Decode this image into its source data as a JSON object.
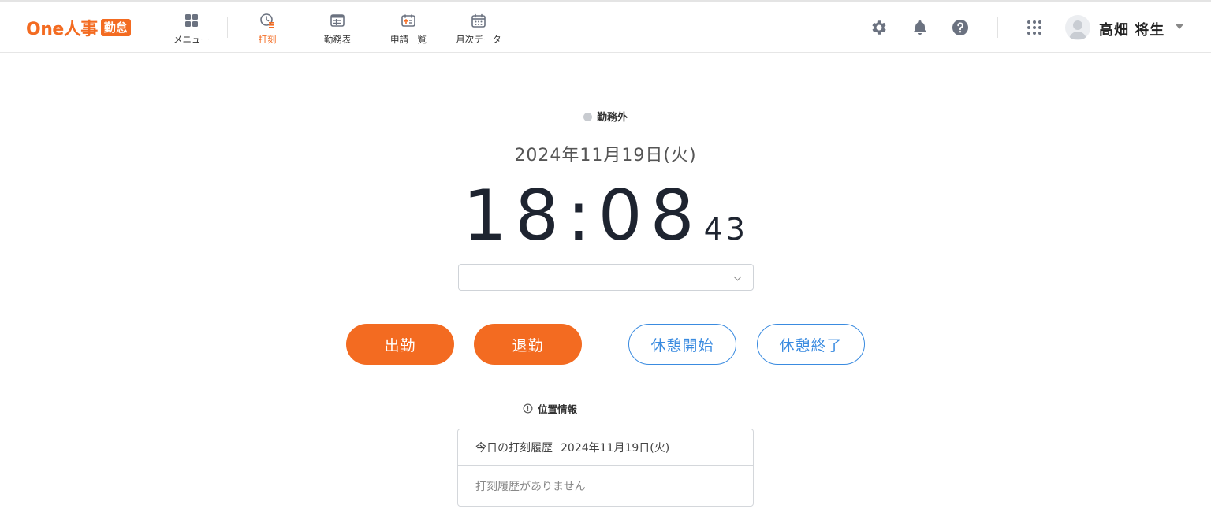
{
  "header": {
    "logo_text": "One人事",
    "logo_badge": "勤怠",
    "nav": [
      {
        "label": "メニュー",
        "icon": "grid-icon",
        "active": false
      },
      {
        "label": "打刻",
        "icon": "clock-icon",
        "active": true
      },
      {
        "label": "勤務表",
        "icon": "timesheet-icon",
        "active": false
      },
      {
        "label": "申請一覧",
        "icon": "application-list-icon",
        "active": false
      },
      {
        "label": "月次データ",
        "icon": "calendar-icon",
        "active": false
      }
    ],
    "icons": [
      "gear-icon",
      "bell-icon",
      "help-icon",
      "apps-grid-icon"
    ],
    "user_name": "高畑 将生"
  },
  "main": {
    "status": "勤務外",
    "date": "2024年11月19日(火)",
    "time_hm": "18:08",
    "time_sec": "43",
    "select_value": "",
    "buttons": {
      "clock_in": "出勤",
      "clock_out": "退勤",
      "break_start": "休憩開始",
      "break_end": "休憩終了"
    },
    "location_label": "位置情報",
    "history": {
      "title": "今日の打刻履歴",
      "date": "2024年11月19日(火)",
      "empty": "打刻履歴がありません"
    }
  },
  "colors": {
    "accent": "#f36b21",
    "link_blue": "#3a8be0",
    "status_off": "#c8cbd0"
  }
}
